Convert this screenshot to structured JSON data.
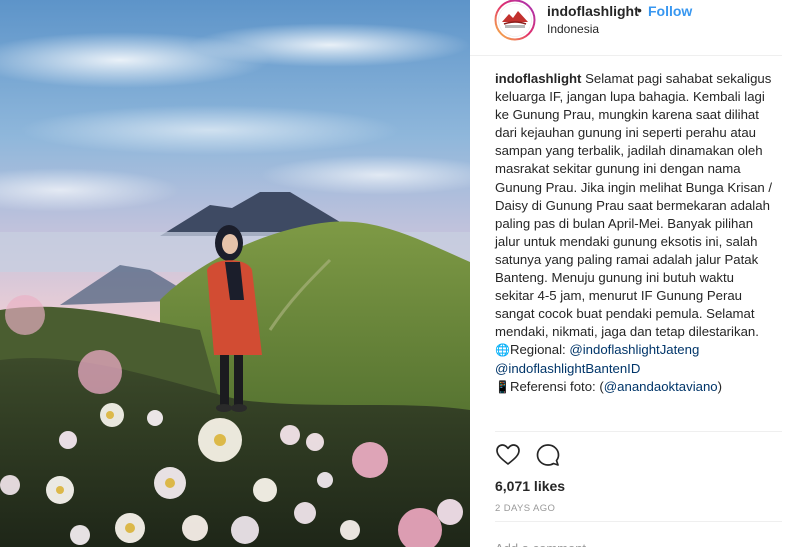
{
  "post": {
    "username": "indoflashlight",
    "separator": "•",
    "follow_label": "Follow",
    "location": "Indonesia",
    "avatar_icon": "indoflashlight-logo-avatar"
  },
  "caption": {
    "username": "indoflashlight",
    "text": "Selamat pagi sahabat sekaligus keluarga IF, jangan lupa bahagia. Kembali lagi ke Gunung Prau, mungkin karena saat dilihat dari kejauhan gunung ini seperti perahu atau sampan yang terbalik, jadilah dinamakan oleh masrakat sekitar gunung ini dengan nama Gunung Prau. Jika ingin melihat Bunga Krisan / Daisy di Gunung Prau saat bermekaran adalah paling pas di bulan April-Mei. Banyak pilihan jalur untuk mendaki gunung eksotis ini, salah satunya yang paling ramai adalah jalur Patak Banteng. Menuju gunung ini butuh waktu sekitar 4-5 jam, menurut IF Gunung Perau sangat cocok buat pendaki pemula. Selamat mendaki, nikmati, jaga dan tetap dilestarikan.",
    "regional_emoji": "🌐",
    "regional_label": "Regional:",
    "regional_tag1": "@indoflashlightJateng",
    "regional_tag2": "@indoflashlightBantenID",
    "ref_emoji": "📱",
    "ref_label": "Referensi foto:",
    "ref_open": "(",
    "ref_tag": "@anandaoktaviano",
    "ref_close": ")"
  },
  "actions": {
    "like_icon": "heart-outline-icon",
    "comment_icon": "speech-bubble-icon"
  },
  "likes_text": "6,071 likes",
  "time_text": "2 DAYS AGO",
  "comment": {
    "placeholder": "Add a comment..."
  },
  "colors": {
    "link_blue": "#3897f0",
    "tag_dark_blue": "#003569",
    "text": "#262626",
    "muted": "#999999",
    "divider": "#efefef"
  }
}
